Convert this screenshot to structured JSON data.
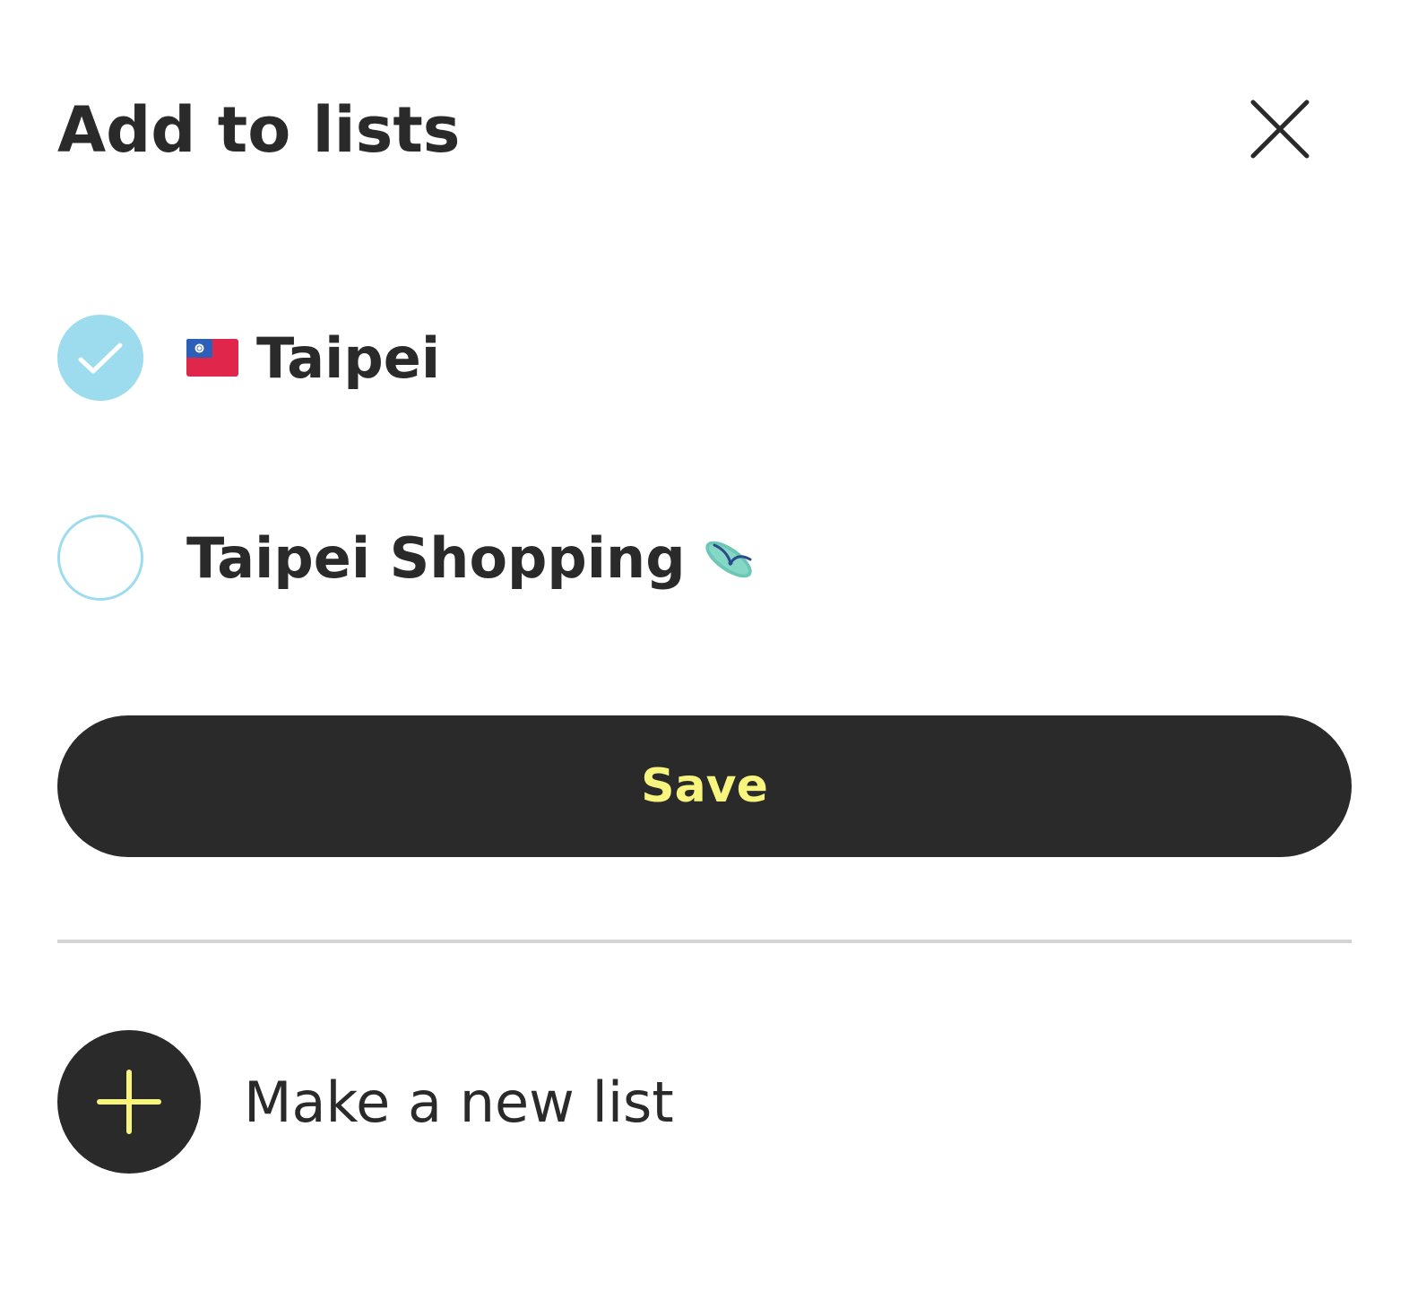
{
  "dialog": {
    "title": "Add to lists",
    "close_icon": "close-icon"
  },
  "lists": [
    {
      "label": "Taipei",
      "checked": true,
      "emoji": "taiwan-flag-icon",
      "emoji_position": "before"
    },
    {
      "label": "Taipei Shopping",
      "checked": false,
      "emoji": "flip-flop-icon",
      "emoji_position": "after"
    }
  ],
  "save_button": {
    "label": "Save"
  },
  "new_list": {
    "label": "Make a new list",
    "icon": "plus-icon"
  },
  "colors": {
    "dark": "#2a2a2a",
    "accent_yellow": "#f7f57d",
    "check_blue": "#9ddcee",
    "divider": "#d4d4d4",
    "background": "#ffffff"
  }
}
